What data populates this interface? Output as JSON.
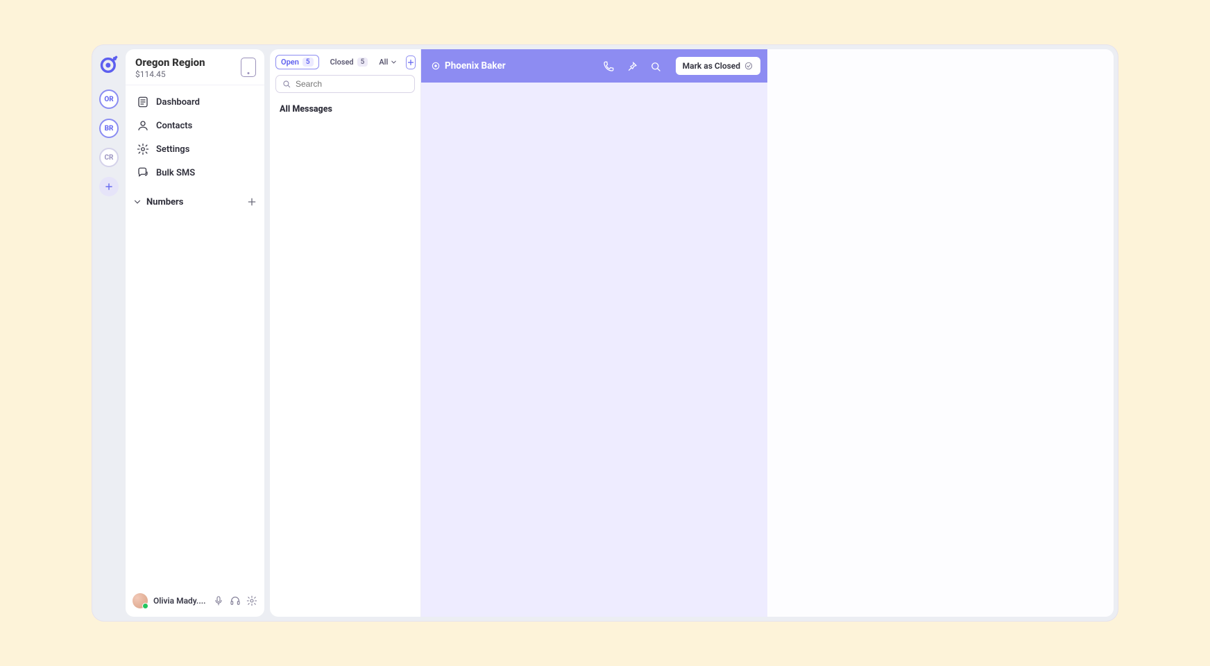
{
  "rail": {
    "workspaces": [
      {
        "initials": "OR",
        "dim": false
      },
      {
        "initials": "BR",
        "dim": false
      },
      {
        "initials": "CR",
        "dim": true
      }
    ]
  },
  "sidebar": {
    "title": "Oregon Region",
    "balance": "$114.45",
    "nav": [
      {
        "label": "Dashboard",
        "icon": "dashboard-icon"
      },
      {
        "label": "Contacts",
        "icon": "contacts-icon"
      },
      {
        "label": "Settings",
        "icon": "settings-icon"
      },
      {
        "label": "Bulk SMS",
        "icon": "bulk-sms-icon"
      }
    ],
    "numbers_label": "Numbers",
    "user_name": "Olivia Mady...."
  },
  "list": {
    "tabs": {
      "open_label": "Open",
      "open_count": "5",
      "closed_label": "Closed",
      "closed_count": "5",
      "all_label": "All"
    },
    "search_placeholder": "Search",
    "section_all_messages": "All Messages"
  },
  "conversation": {
    "contact_name": "Phoenix Baker",
    "mark_closed_label": "Mark as Closed"
  }
}
